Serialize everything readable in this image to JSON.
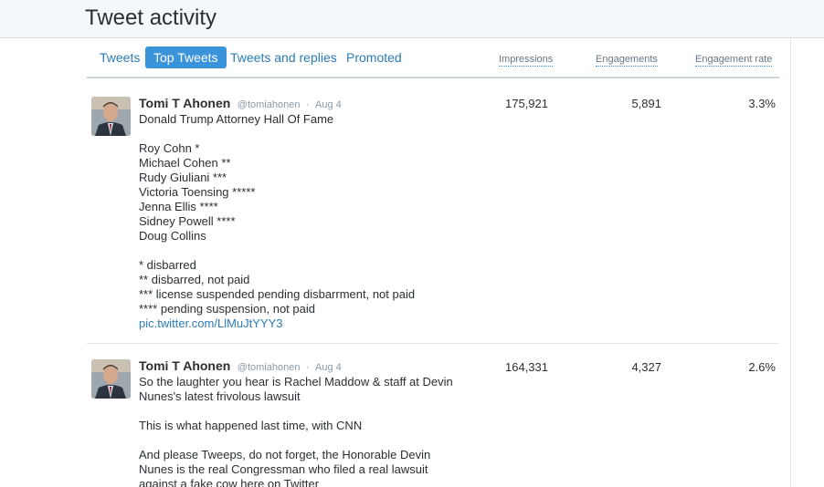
{
  "page": {
    "title": "Tweet activity"
  },
  "tabs": [
    {
      "label": "Tweets",
      "active": false
    },
    {
      "label": "Top Tweets",
      "active": true
    },
    {
      "label": "Tweets and replies",
      "active": false
    },
    {
      "label": "Promoted",
      "active": false
    }
  ],
  "columns": {
    "impressions": "Impressions",
    "engagements": "Engagements",
    "engagement_rate": "Engagement rate"
  },
  "tweets": [
    {
      "author": "Tomi T Ahonen",
      "handle": "@tomiahonen",
      "separator": "·",
      "date": "Aug 4",
      "lines": [
        "Donald Trump Attorney Hall Of Fame",
        "",
        "Roy Cohn *",
        "Michael Cohen **",
        "Rudy Giuliani ***",
        "Victoria Toensing *****",
        "Jenna Ellis ****",
        "Sidney Powell ****",
        "Doug Collins",
        "",
        "* disbarred",
        "** disbarred, not paid",
        "*** license suspended pending disbarrment, not paid",
        "**** pending suspension, not paid"
      ],
      "link": "pic.twitter.com/LlMuJtYYY3",
      "impressions": "175,921",
      "engagements": "5,891",
      "engagement_rate": "3.3%"
    },
    {
      "author": "Tomi T Ahonen",
      "handle": "@tomiahonen",
      "separator": "·",
      "date": "Aug 4",
      "lines": [
        "So the laughter you hear is Rachel Maddow & staff at Devin",
        "Nunes's latest frivolous lawsuit",
        "",
        "This is what happened last time, with CNN",
        "",
        "And please Tweeps, do not forget, the Honorable Devin",
        "Nunes is the real Congressman who filed a real lawsuit",
        "against a fake cow here on Twitter"
      ],
      "link": "",
      "impressions": "164,331",
      "engagements": "4,327",
      "engagement_rate": "2.6%"
    }
  ]
}
